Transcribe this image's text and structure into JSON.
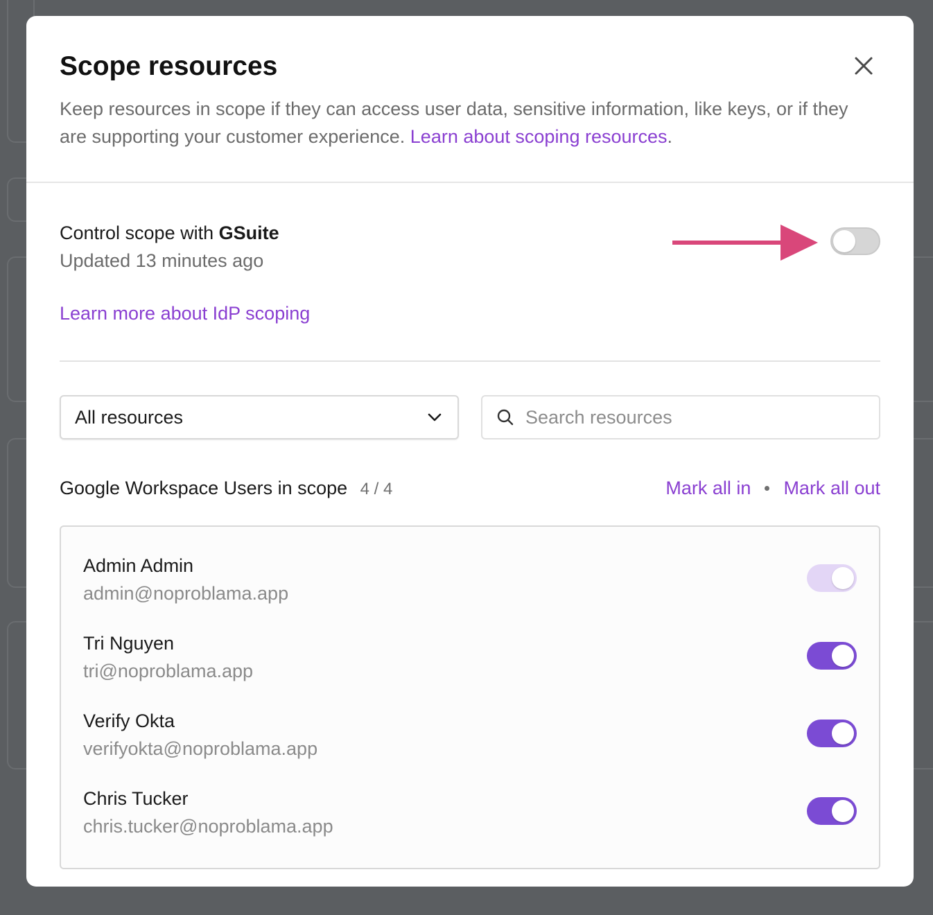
{
  "modal": {
    "title": "Scope resources",
    "description": "Keep resources in scope if they can access user data, sensitive information, like keys, or if they are supporting your customer experience.",
    "description_link": "Learn about scoping resources",
    "description_end": "."
  },
  "control": {
    "title_prefix": "Control scope with",
    "provider": "GSuite",
    "updated": "Updated 13 minutes ago",
    "toggle_state": "off",
    "idp_link": "Learn more about IdP scoping"
  },
  "filters": {
    "select_value": "All resources",
    "search_placeholder": "Search resources"
  },
  "list": {
    "title": "Google Workspace Users in scope",
    "count": "4 / 4",
    "mark_all_in": "Mark all in",
    "mark_all_out": "Mark all out",
    "users": [
      {
        "name": "Admin Admin",
        "email": "admin@noproblama.app",
        "toggle": "disabled"
      },
      {
        "name": "Tri Nguyen",
        "email": "tri@noproblama.app",
        "toggle": "on"
      },
      {
        "name": "Verify Okta",
        "email": "verifyokta@noproblama.app",
        "toggle": "on"
      },
      {
        "name": "Chris Tucker",
        "email": "chris.tucker@noproblama.app",
        "toggle": "on"
      }
    ]
  },
  "colors": {
    "accent": "#8a3fd1",
    "toggle_on": "#7b4bd4",
    "arrow": "#d9477a"
  },
  "icons": {
    "close": "close-icon",
    "chevron": "chevron-down-icon",
    "search": "search-icon",
    "arrow": "arrow-right-icon"
  }
}
